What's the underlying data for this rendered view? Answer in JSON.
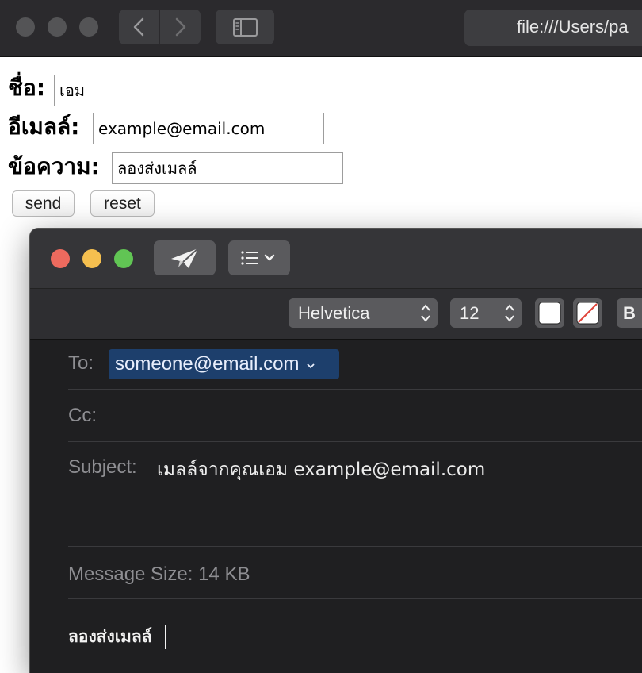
{
  "browser": {
    "url": "file:///Users/pa"
  },
  "form": {
    "name_label": "ชื่อ:",
    "name_value": "เอม",
    "email_label": "อีเมลล์:",
    "email_value": "example@email.com",
    "message_label": "ข้อความ:",
    "message_value": "ลองส่งเมลล์",
    "send_label": "send",
    "reset_label": "reset"
  },
  "mail": {
    "font_name": "Helvetica",
    "font_size": "12",
    "bold_label": "B",
    "to_label": "To:",
    "to_value": "someone@email.com",
    "cc_label": "Cc:",
    "subject_label": "Subject:",
    "subject_value": "เมลล์จากคุณเอม example@email.com",
    "message_size": "Message Size: 14 KB",
    "body_text": "ลองส่งเมลล์",
    "colors": {
      "close": "#ed6a5e",
      "minimize": "#f5bf4f",
      "zoom": "#61c554",
      "token_bg": "#1d3f6c"
    }
  }
}
